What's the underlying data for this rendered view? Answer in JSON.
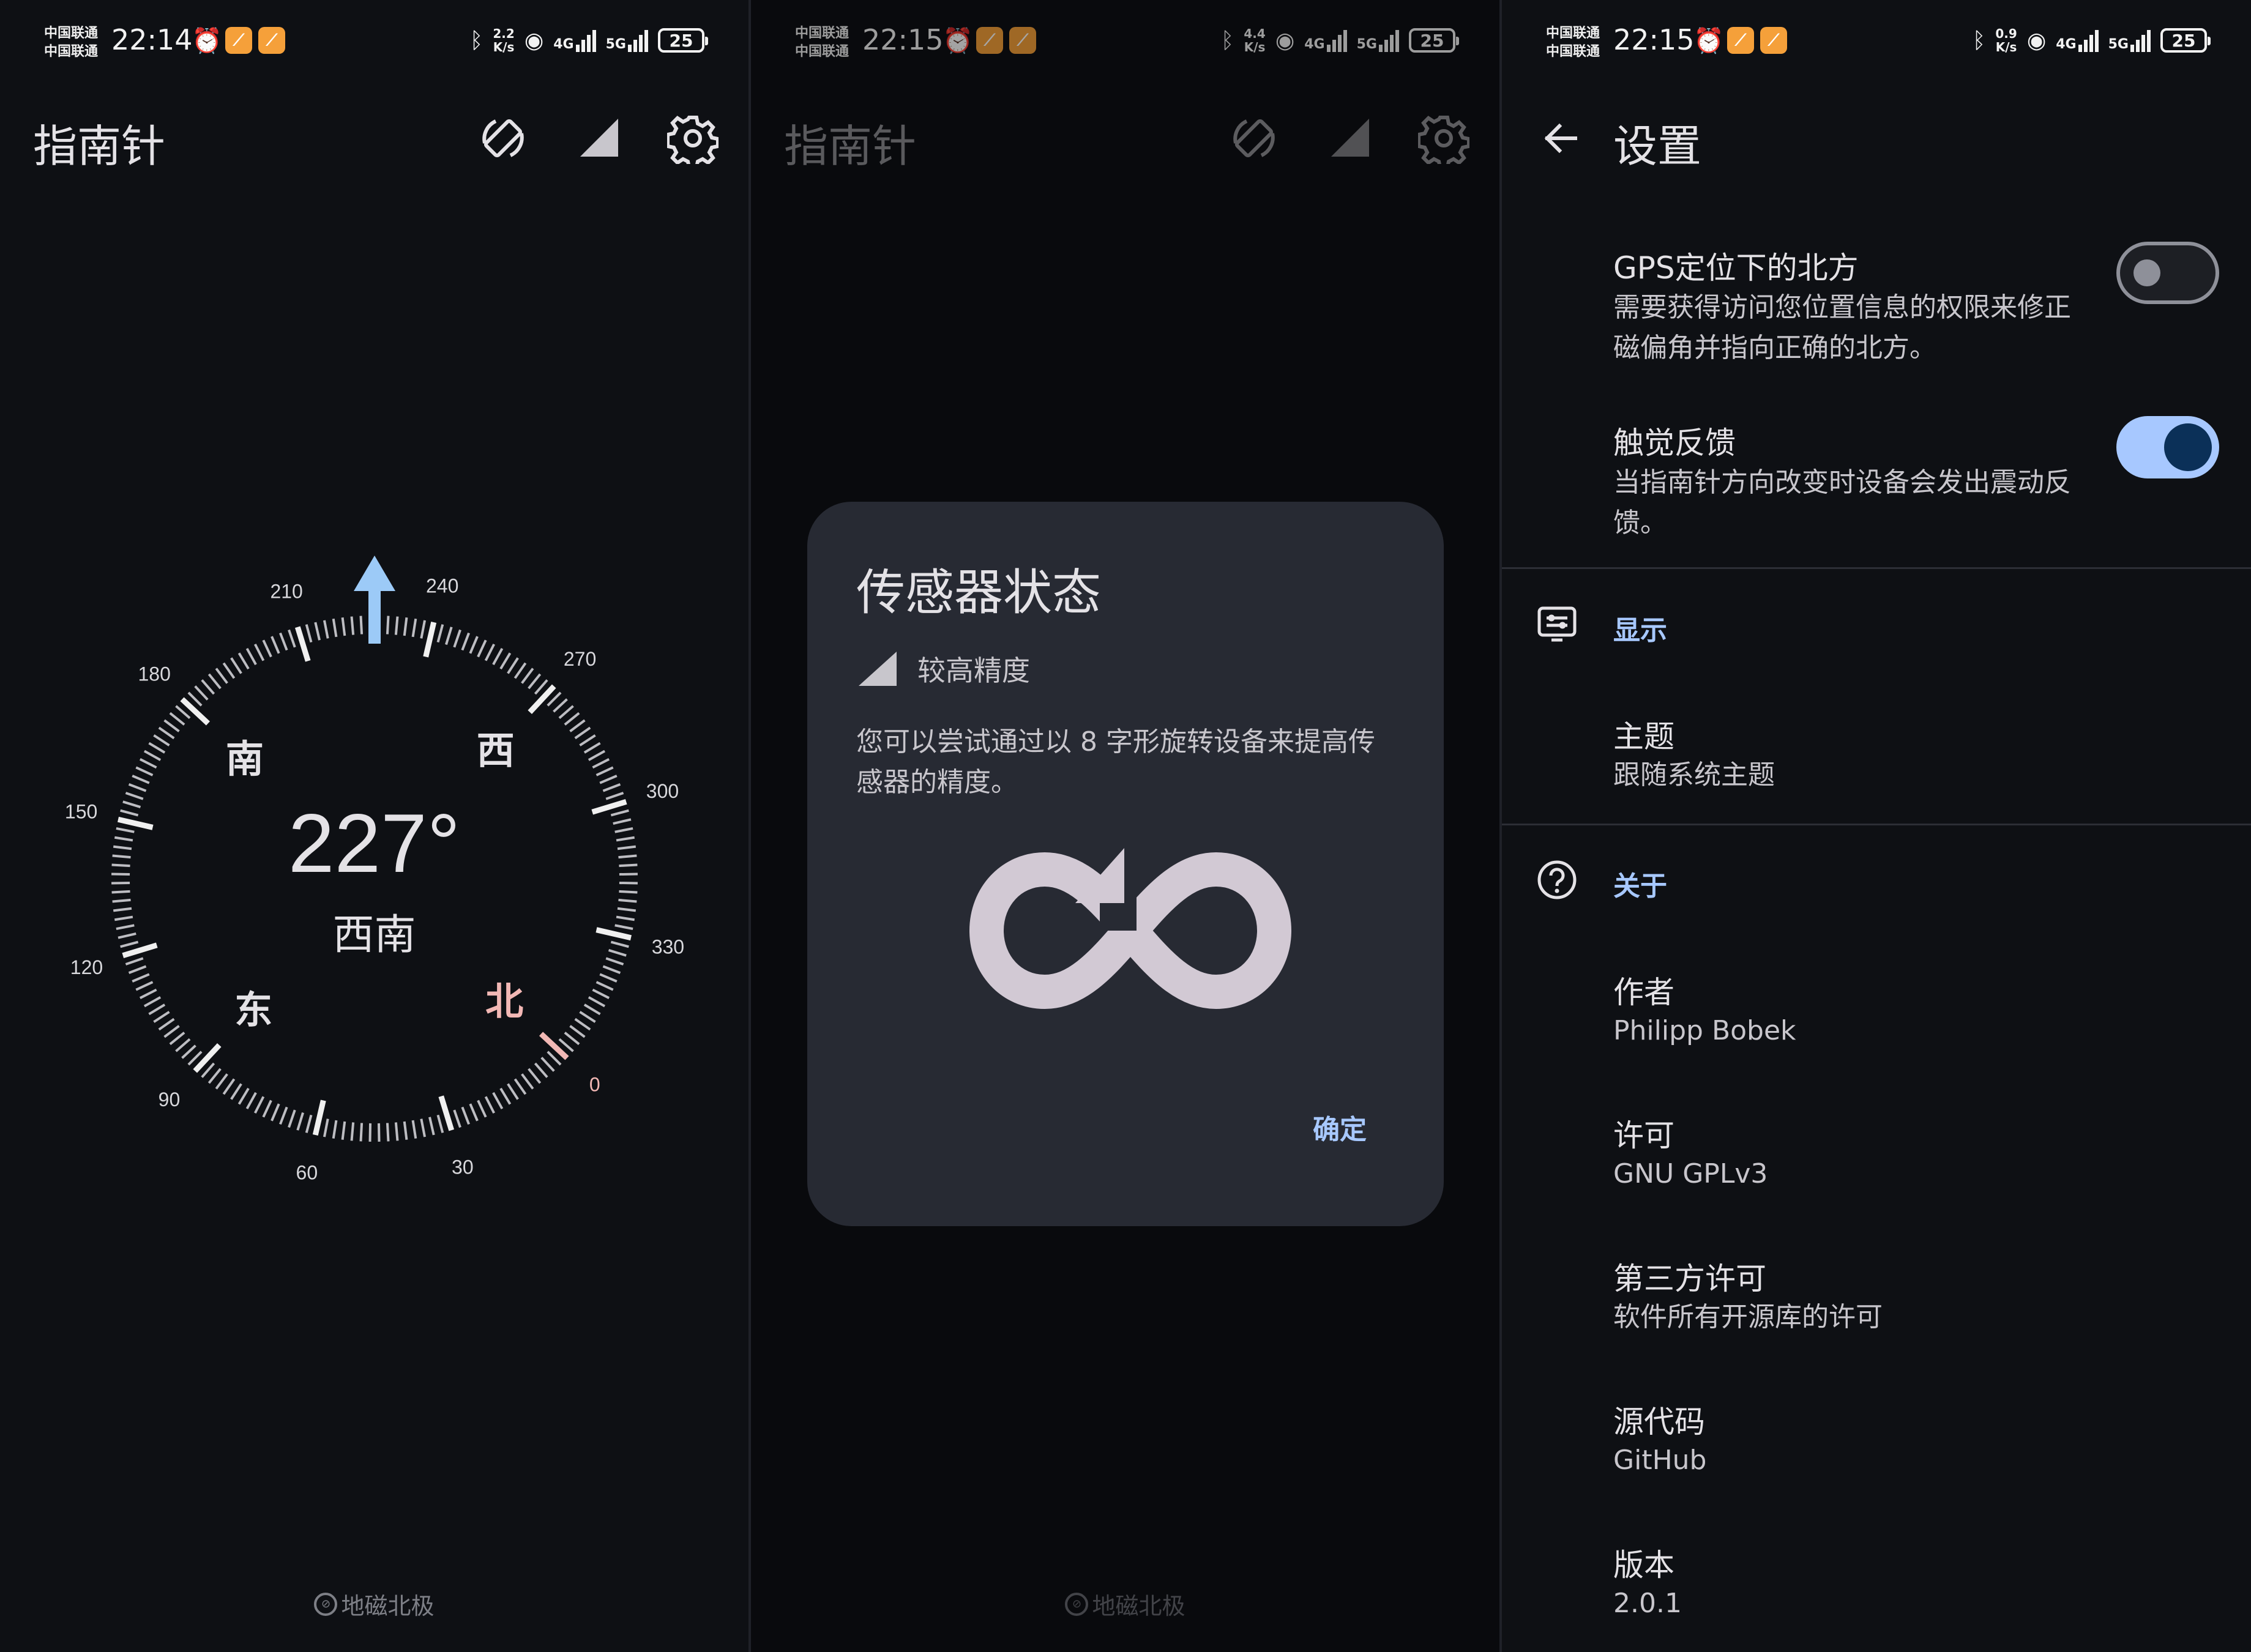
{
  "status_bars": [
    {
      "carrier_1": "中国联通",
      "carrier_2": "中国联通",
      "time": "22:14",
      "speed": "2.2",
      "speed_unit": "K/s",
      "net1": "4G",
      "net2": "5G",
      "battery": "25"
    },
    {
      "carrier_1": "中国联通",
      "carrier_2": "中国联通",
      "time": "22:15",
      "speed": "4.4",
      "speed_unit": "K/s",
      "net1": "4G",
      "net2": "5G",
      "battery": "25"
    },
    {
      "carrier_1": "中国联通",
      "carrier_2": "中国联通",
      "time": "22:15",
      "speed": "0.9",
      "speed_unit": "K/s",
      "net1": "4G",
      "net2": "5G",
      "battery": "25"
    }
  ],
  "compass": {
    "app_title": "指南针",
    "heading_value": "227°",
    "heading_direction": "西南",
    "heading_deg": 227,
    "cardinals": {
      "north": "北",
      "east": "东",
      "south": "南",
      "west": "西"
    },
    "tick_labels": [
      "0",
      "30",
      "60",
      "90",
      "120",
      "150",
      "180",
      "210",
      "240",
      "270",
      "300",
      "330"
    ],
    "footer": "地磁北极",
    "footer_icon_glyph": "⊘",
    "icons": [
      "screen-rotation-icon",
      "signal-accuracy-icon",
      "gear-icon"
    ],
    "colors": {
      "accent_arrow": "#9ccaf7",
      "north_marker": "#f2b8b5",
      "background": "#0e1014"
    }
  },
  "dialog": {
    "title": "传感器状态",
    "accuracy_label": "较高精度",
    "message": "您可以尝试通过以 8 字形旋转设备来提高传感器的精度。",
    "confirm": "确定",
    "illustration": "figure-eight-rotate-icon"
  },
  "settings": {
    "title": "设置",
    "gps_north": {
      "title": "GPS定位下的北方",
      "subtitle": "需要获得访问您位置信息的权限来修正磁偏角并指向正确的北方。",
      "enabled": false
    },
    "haptic": {
      "title": "触觉反馈",
      "subtitle": "当指南针方向改变时设备会发出震动反馈。",
      "enabled": true
    },
    "display_section": "显示",
    "theme": {
      "title": "主题",
      "value": "跟随系统主题"
    },
    "about_section": "关于",
    "author": {
      "title": "作者",
      "value": "Philipp Bobek"
    },
    "license": {
      "title": "许可",
      "value": "GNU GPLv3"
    },
    "third_party": {
      "title": "第三方许可",
      "value": "软件所有开源库的许可"
    },
    "source": {
      "title": "源代码",
      "value": "GitHub"
    },
    "version": {
      "title": "版本",
      "value": "2.0.1"
    },
    "colors": {
      "accent": "#a7c8ff",
      "toggle_on_track": "#a7c8ff",
      "toggle_on_knob": "#0b3058"
    }
  }
}
